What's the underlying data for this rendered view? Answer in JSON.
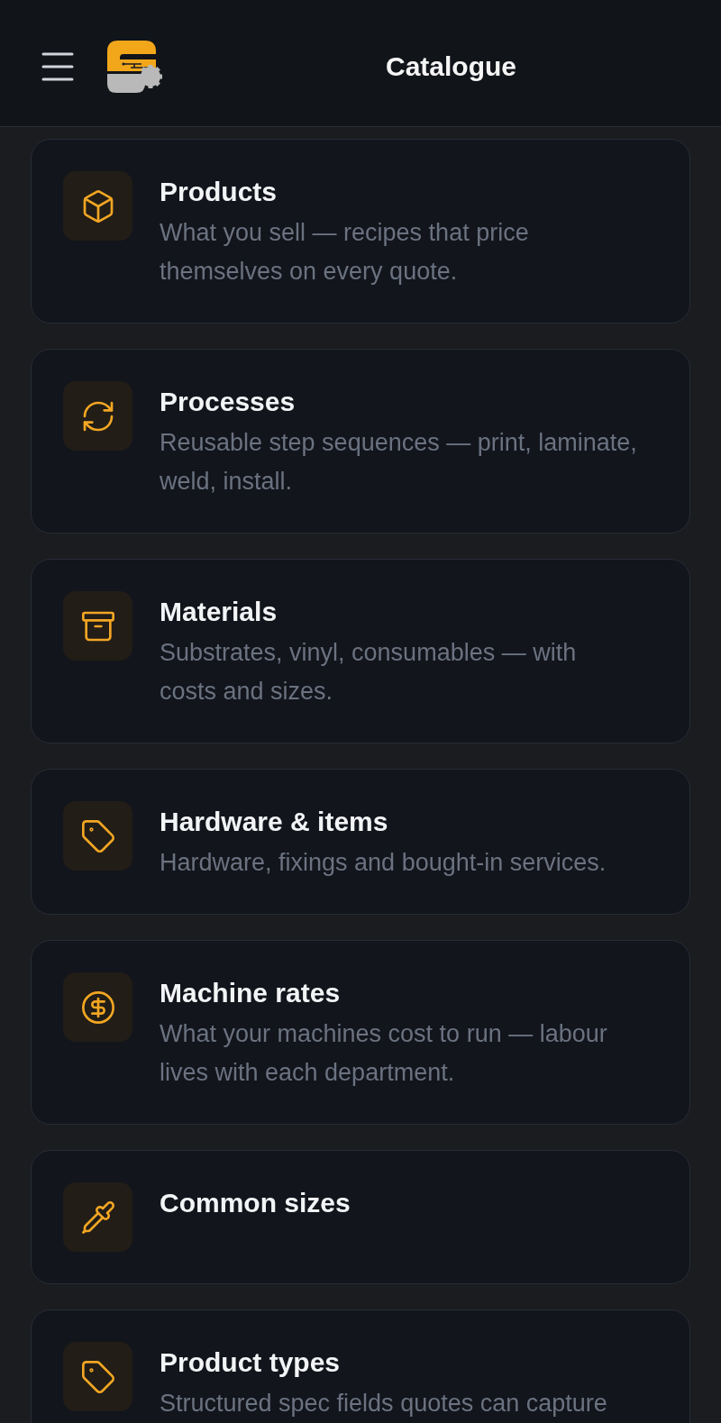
{
  "header": {
    "title": "Catalogue"
  },
  "cards": [
    {
      "title": "Products",
      "description_lines": [
        "What you sell — recipes that price",
        "themselves on every quote."
      ]
    },
    {
      "title": "Processes",
      "description_lines": [
        "Reusable step sequences — print, laminate,",
        "weld, install."
      ]
    },
    {
      "title": "Materials",
      "description_lines": [
        "Substrates, vinyl, consumables — with",
        "costs and sizes."
      ]
    },
    {
      "title": "Hardware & items",
      "description_lines": [
        "Hardware, fixings and bought-in services."
      ]
    },
    {
      "title": "Machine rates",
      "description_lines": [
        "What your machines cost to run — labour",
        "lives with each department."
      ]
    },
    {
      "title": "Common sizes"
    },
    {
      "title": "Product types",
      "description_lines": [
        "Structured spec fields quotes can capture"
      ]
    }
  ]
}
